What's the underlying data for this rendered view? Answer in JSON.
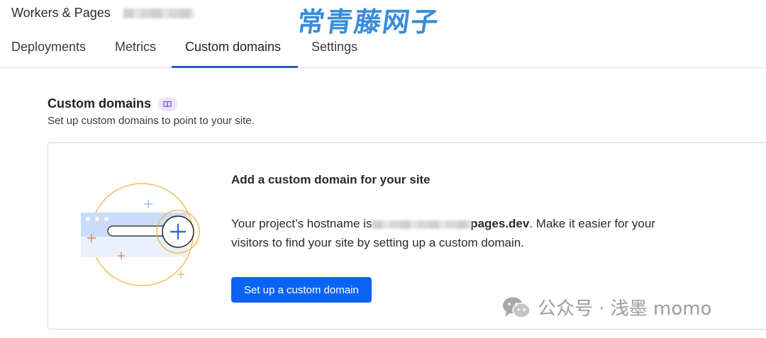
{
  "breadcrumb": {
    "root": "Workers & Pages"
  },
  "watermark": {
    "top": "常青藤网子",
    "bottom": "公众号 · 浅墨 momo"
  },
  "tabs": [
    {
      "label": "Deployments",
      "active": false
    },
    {
      "label": "Metrics",
      "active": false
    },
    {
      "label": "Custom domains",
      "active": true
    },
    {
      "label": "Settings",
      "active": false
    }
  ],
  "section": {
    "title": "Custom domains",
    "subtitle": "Set up custom domains to point to your site."
  },
  "card": {
    "heading": "Add a custom domain for your site",
    "body_prefix": "Your project’s hostname is",
    "hostname_suffix": "pages.dev",
    "body_suffix": ". Make it easier for your visitors to find your site by setting up a custom domain.",
    "cta_label": "Set up a custom domain"
  },
  "colors": {
    "accent": "#0b63f6",
    "tab_underline": "#1e5fc8",
    "illustration_ring": "#e9b53c"
  },
  "icons": {
    "docs": "book-icon",
    "plus": "plus-icon",
    "wechat": "wechat-icon"
  }
}
